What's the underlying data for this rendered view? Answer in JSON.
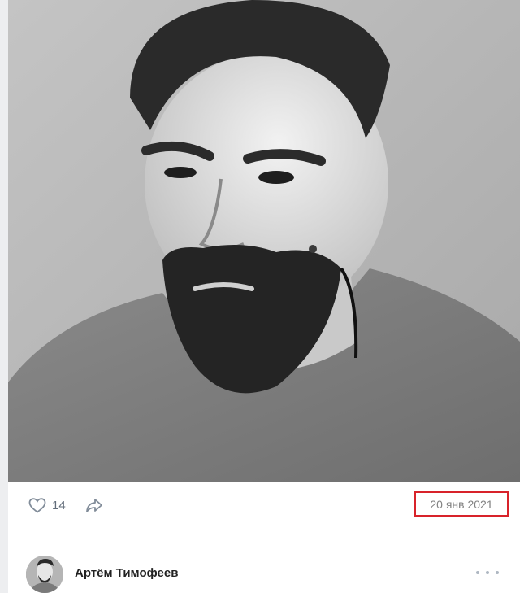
{
  "photo": {
    "alt_icon": "portrait-photo",
    "tone": "black-and-white"
  },
  "actions": {
    "like_icon": "heart-icon",
    "like_count": "14",
    "share_icon": "share-arrow-icon",
    "date": "20 янв 2021",
    "date_highlight_color": "#d8232a"
  },
  "author": {
    "name": "Артём Тимофеев",
    "more_icon": "more-dots-icon"
  },
  "colors": {
    "background": "#edeef0",
    "card": "#ffffff",
    "icon": "#99a2ad",
    "text_secondary": "#828282"
  }
}
